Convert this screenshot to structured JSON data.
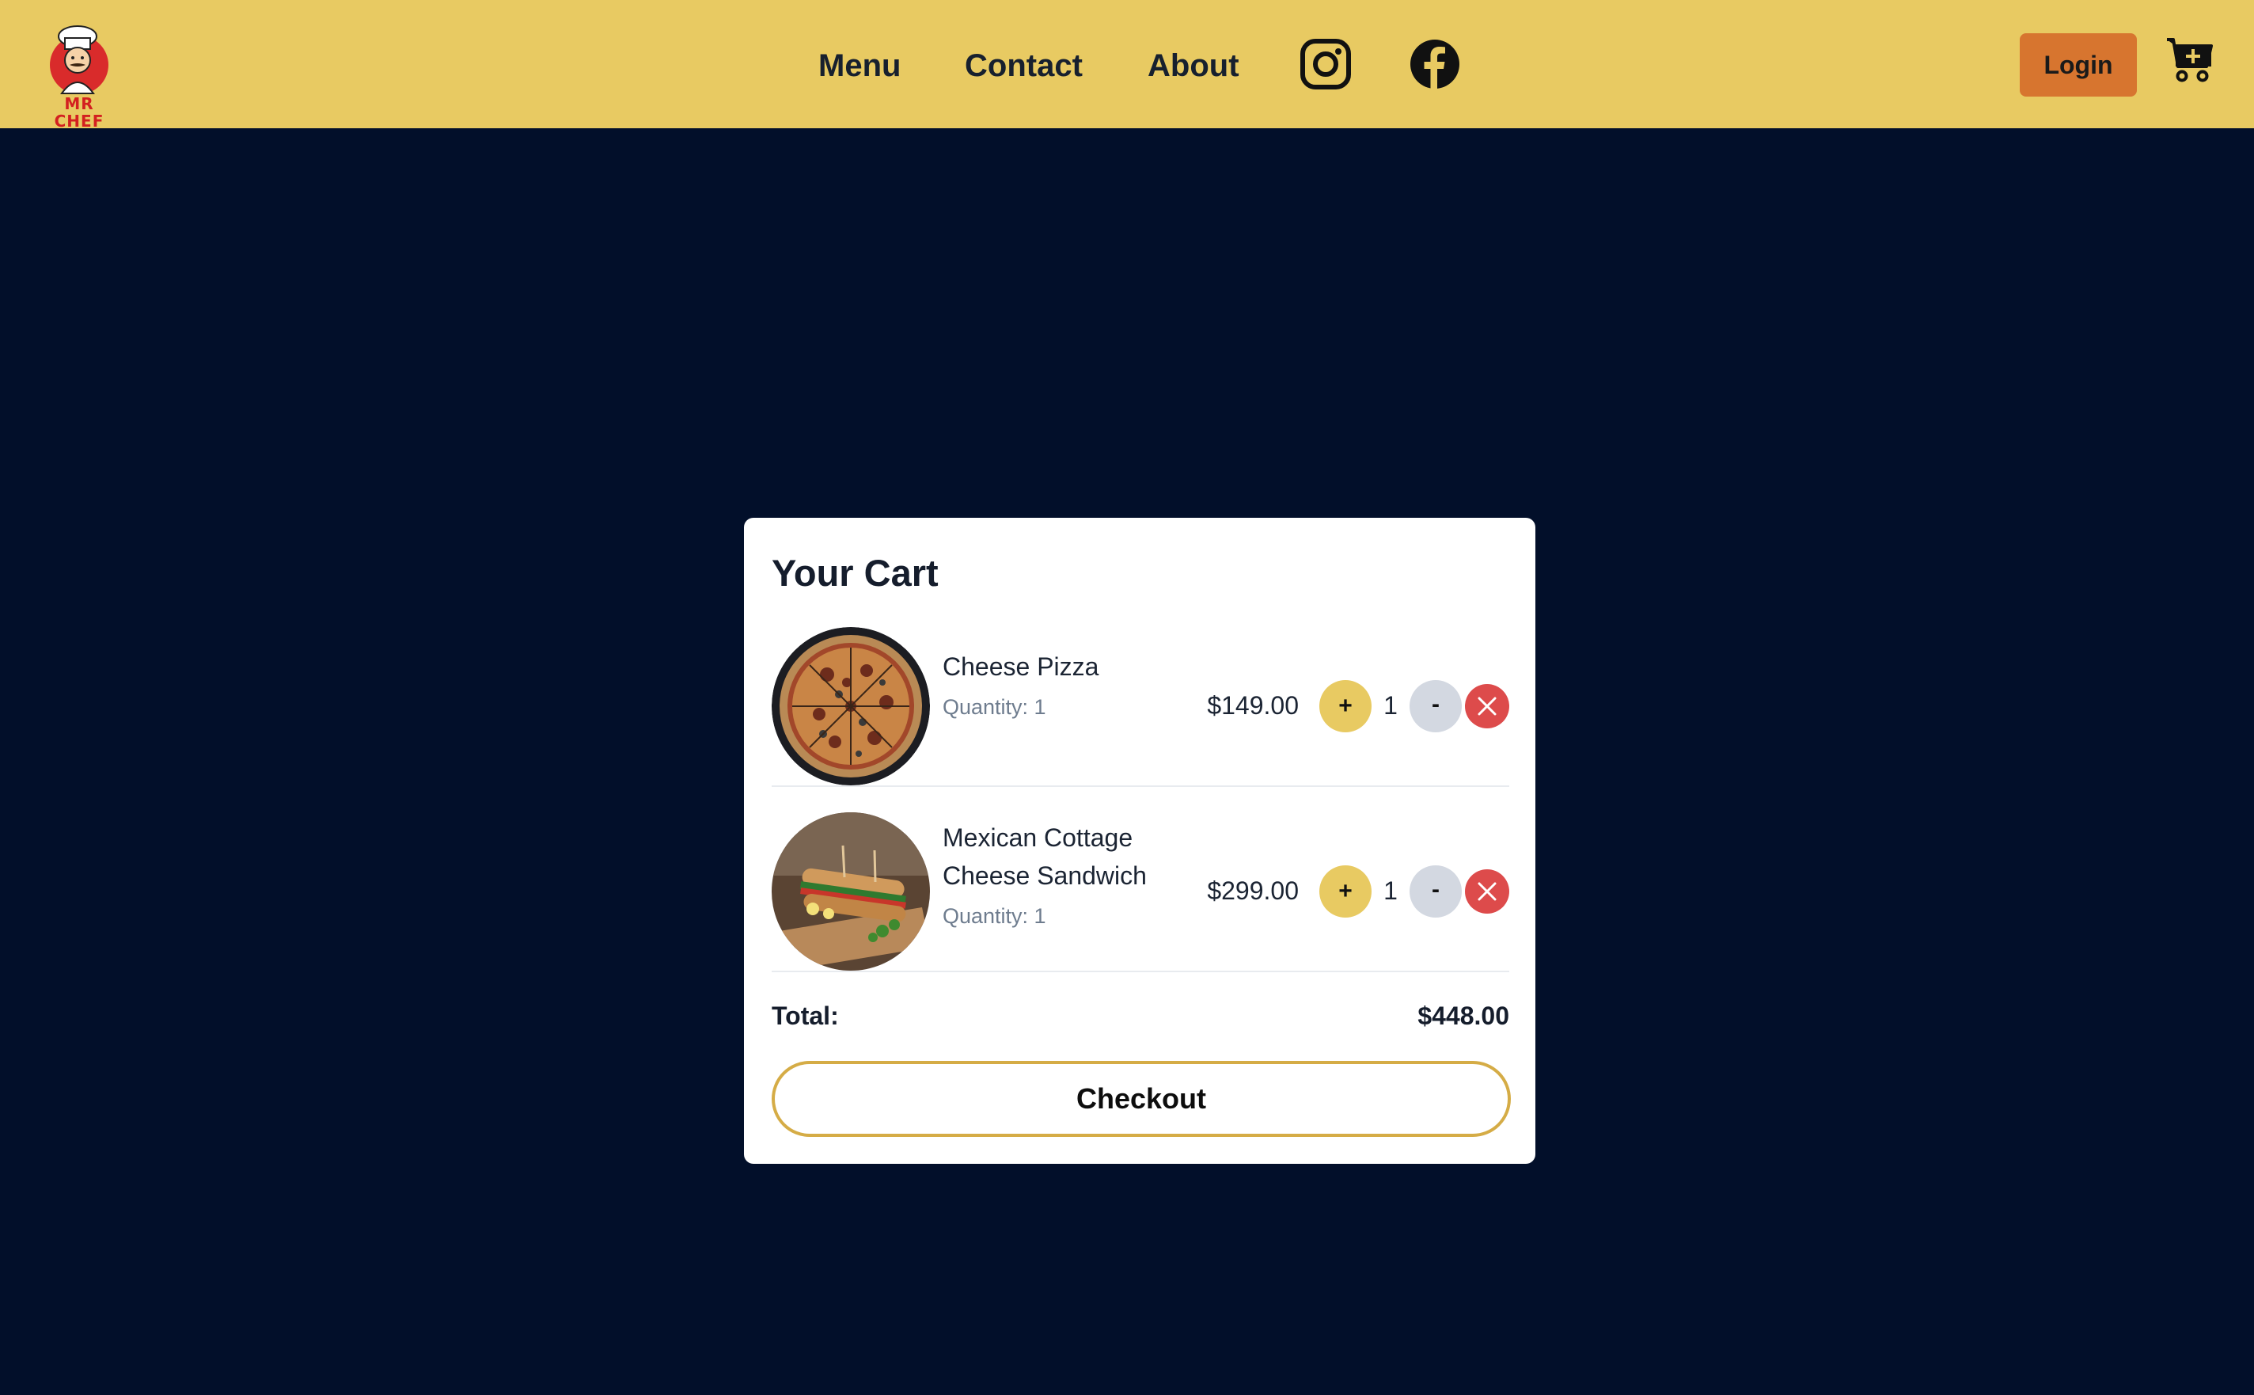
{
  "brand": {
    "logo_text": "MR CHEF"
  },
  "nav": {
    "links": [
      "Menu",
      "Contact",
      "About"
    ],
    "social": [
      "instagram-icon",
      "facebook-icon"
    ],
    "login_label": "Login",
    "cart_icon": "cart-plus-icon"
  },
  "cart": {
    "title": "Your Cart",
    "items": [
      {
        "name": "Cheese Pizza",
        "quantity_label": "Quantity: 1",
        "price": "$149.00",
        "quantity": "1",
        "plus_label": "+",
        "minus_label": "-"
      },
      {
        "name_line1": "Mexican Cottage",
        "name_line2": "Cheese Sandwich",
        "quantity_label": "Quantity: 1",
        "price": "$299.00",
        "quantity": "1",
        "plus_label": "+",
        "minus_label": "-"
      }
    ],
    "total_label": "Total:",
    "total_value": "$448.00",
    "checkout_label": "Checkout"
  },
  "colors": {
    "header_bg": "#e8ca62",
    "page_bg": "#020f2a",
    "login_bg": "#d7752f",
    "plus_bg": "#e8ca62",
    "minus_bg": "#d3d8e1",
    "remove_bg": "#dd4b4b",
    "checkout_border": "#d5ac46"
  }
}
